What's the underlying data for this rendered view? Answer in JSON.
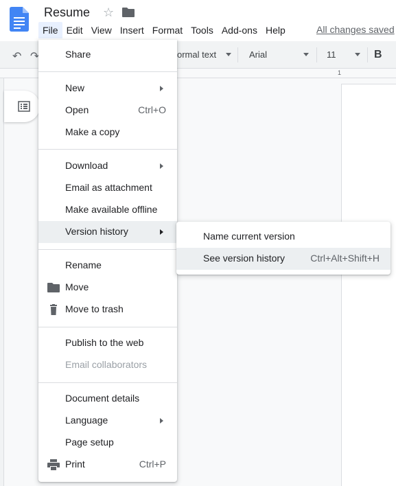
{
  "doc": {
    "title": "Resume",
    "star_icon": "☆",
    "saved_status": "All changes saved"
  },
  "menubar": [
    "File",
    "Edit",
    "View",
    "Insert",
    "Format",
    "Tools",
    "Add-ons",
    "Help"
  ],
  "toolbar": {
    "style_value": "ormal text",
    "font_value": "Arial",
    "size_value": "11",
    "bold_label": "B",
    "undo_icon": "↶",
    "redo_icon": "↷"
  },
  "ruler": {
    "marker": "1"
  },
  "file_menu": {
    "share": "Share",
    "new": "New",
    "open": "Open",
    "open_shortcut": "Ctrl+O",
    "make_copy": "Make a copy",
    "download": "Download",
    "email_attachment": "Email as attachment",
    "offline": "Make available offline",
    "version_history": "Version history",
    "rename": "Rename",
    "move": "Move",
    "trash": "Move to trash",
    "publish": "Publish to the web",
    "email_collab": "Email collaborators",
    "details": "Document details",
    "language": "Language",
    "page_setup": "Page setup",
    "print": "Print",
    "print_shortcut": "Ctrl+P"
  },
  "version_submenu": {
    "name_version": "Name current version",
    "see_history": "See version history",
    "see_history_shortcut": "Ctrl+Alt+Shift+H"
  },
  "colors": {
    "brand_blue": "#4285f4",
    "menu_hover": "#eceff1",
    "active_menu_bg": "#e8f0fe"
  }
}
